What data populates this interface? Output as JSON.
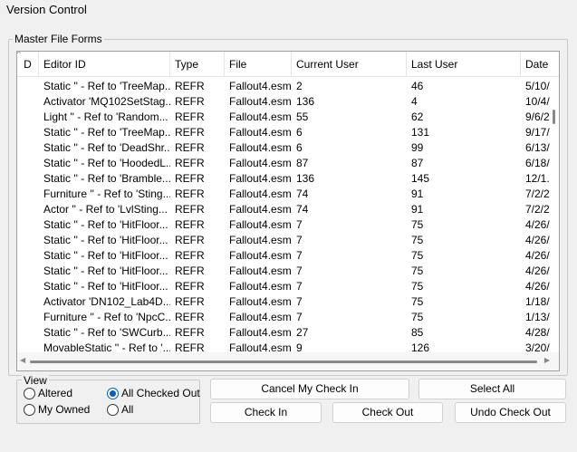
{
  "window": {
    "title": "Version Control"
  },
  "master_group": {
    "label": "Master File Forms"
  },
  "list": {
    "columns": [
      {
        "key": "d",
        "label": "D"
      },
      {
        "key": "editor_id",
        "label": "Editor ID"
      },
      {
        "key": "type",
        "label": "Type"
      },
      {
        "key": "file",
        "label": "File"
      },
      {
        "key": "current_user",
        "label": "Current User"
      },
      {
        "key": "last_user",
        "label": "Last User"
      },
      {
        "key": "date",
        "label": "Date"
      }
    ],
    "rows": [
      {
        "d": "",
        "editor_id": "Static '' - Ref to 'TreeMap...",
        "type": "REFR",
        "file": "Fallout4.esm",
        "current_user": "2",
        "last_user": "46",
        "date": "5/10/..."
      },
      {
        "d": "",
        "editor_id": "Activator 'MQ102SetStag...",
        "type": "REFR",
        "file": "Fallout4.esm",
        "current_user": "136",
        "last_user": "4",
        "date": "10/4/..."
      },
      {
        "d": "",
        "editor_id": "Light '' - Ref to 'Random...",
        "type": "REFR",
        "file": "Fallout4.esm",
        "current_user": "55",
        "last_user": "62",
        "date": "9/6/2..."
      },
      {
        "d": "",
        "editor_id": "Static '' - Ref to 'TreeMap...",
        "type": "REFR",
        "file": "Fallout4.esm",
        "current_user": "6",
        "last_user": "131",
        "date": "9/17/..."
      },
      {
        "d": "",
        "editor_id": "Static '' - Ref to 'DeadShr...",
        "type": "REFR",
        "file": "Fallout4.esm",
        "current_user": "6",
        "last_user": "99",
        "date": "6/13/..."
      },
      {
        "d": "",
        "editor_id": "Static '' - Ref to 'HoodedL...",
        "type": "REFR",
        "file": "Fallout4.esm",
        "current_user": "87",
        "last_user": "87",
        "date": "6/18/..."
      },
      {
        "d": "",
        "editor_id": "Static '' - Ref to 'Bramble...",
        "type": "REFR",
        "file": "Fallout4.esm",
        "current_user": "136",
        "last_user": "145",
        "date": "12/1..."
      },
      {
        "d": "",
        "editor_id": "Furniture '' - Ref to 'Sting...",
        "type": "REFR",
        "file": "Fallout4.esm",
        "current_user": "74",
        "last_user": "91",
        "date": "7/2/2..."
      },
      {
        "d": "",
        "editor_id": "Actor '' - Ref to 'LvlSting...",
        "type": "REFR",
        "file": "Fallout4.esm",
        "current_user": "74",
        "last_user": "91",
        "date": "7/2/2..."
      },
      {
        "d": "",
        "editor_id": "Static '' - Ref to 'HitFloor...",
        "type": "REFR",
        "file": "Fallout4.esm",
        "current_user": "7",
        "last_user": "75",
        "date": "4/26/..."
      },
      {
        "d": "",
        "editor_id": "Static '' - Ref to 'HitFloor...",
        "type": "REFR",
        "file": "Fallout4.esm",
        "current_user": "7",
        "last_user": "75",
        "date": "4/26/..."
      },
      {
        "d": "",
        "editor_id": "Static '' - Ref to 'HitFloor...",
        "type": "REFR",
        "file": "Fallout4.esm",
        "current_user": "7",
        "last_user": "75",
        "date": "4/26/..."
      },
      {
        "d": "",
        "editor_id": "Static '' - Ref to 'HitFloor...",
        "type": "REFR",
        "file": "Fallout4.esm",
        "current_user": "7",
        "last_user": "75",
        "date": "4/26/..."
      },
      {
        "d": "",
        "editor_id": "Static '' - Ref to 'HitFloor...",
        "type": "REFR",
        "file": "Fallout4.esm",
        "current_user": "7",
        "last_user": "75",
        "date": "4/26/..."
      },
      {
        "d": "",
        "editor_id": "Activator 'DN102_Lab4D...",
        "type": "REFR",
        "file": "Fallout4.esm",
        "current_user": "7",
        "last_user": "75",
        "date": "1/18/..."
      },
      {
        "d": "",
        "editor_id": "Furniture '' - Ref to 'NpcC...",
        "type": "REFR",
        "file": "Fallout4.esm",
        "current_user": "7",
        "last_user": "75",
        "date": "1/13/..."
      },
      {
        "d": "",
        "editor_id": "Static '' - Ref to 'SWCurb...",
        "type": "REFR",
        "file": "Fallout4.esm",
        "current_user": "27",
        "last_user": "85",
        "date": "4/28/..."
      },
      {
        "d": "",
        "editor_id": "MovableStatic '' - Ref to '...",
        "type": "REFR",
        "file": "Fallout4.esm",
        "current_user": "9",
        "last_user": "126",
        "date": "3/20/..."
      }
    ]
  },
  "view": {
    "label": "View",
    "options": [
      {
        "label": "Altered",
        "checked": false
      },
      {
        "label": "All Checked Out",
        "checked": true
      },
      {
        "label": "My Owned",
        "checked": false
      },
      {
        "label": "All",
        "checked": false
      }
    ]
  },
  "buttons": {
    "cancel_my_check_in": "Cancel My Check In",
    "select_all": "Select All",
    "check_in": "Check In",
    "check_out": "Check Out",
    "undo_check_out": "Undo Check Out"
  },
  "colors": {
    "accent": "#005fb8",
    "background": "#f0f0f0"
  }
}
